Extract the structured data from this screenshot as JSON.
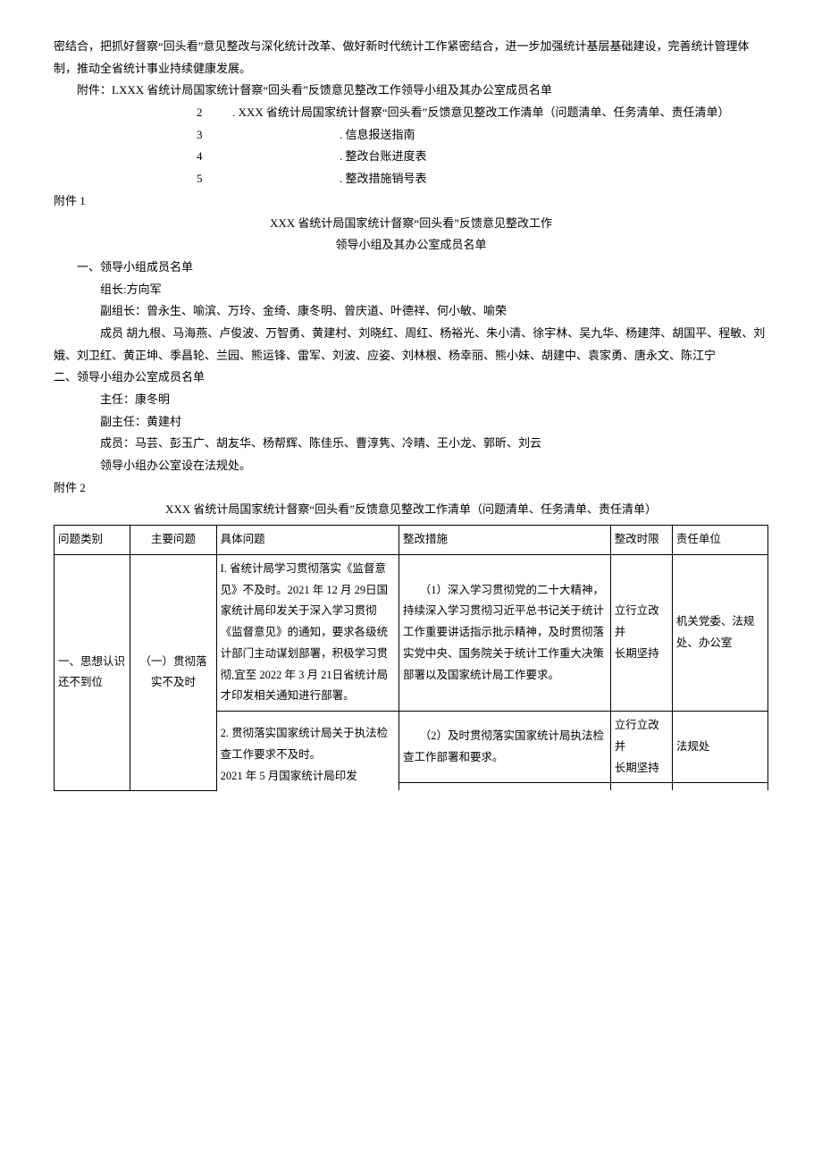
{
  "intro_para": "密结合，把抓好督察“回头看”意见整改与深化统计改革、做好新时代统计工作紧密结合，进一步加强统计基层基础建设，完善统计管理体制，推动全省统计事业持续健康发展。",
  "attach_label": "附件：",
  "attachments": {
    "a1": "LXXX 省统计局国家统计督察“回头看”反馈意见整改工作领导小组及其办公室成员名单",
    "a2_num": "2",
    "a2_text": ". XXX 省统计局国家统计督察“回头看”反馈意见整改工作清单（问题清单、任务清单、责任清单）",
    "a3_num": "3",
    "a3_text": ". 信息报送指南",
    "a4_num": "4",
    "a4_text": ". 整改台账进度表",
    "a5_num": "5",
    "a5_text": ". 整改措施销号表"
  },
  "fj1_label": "附件 1",
  "fj1_title1": "XXX 省统计局国家统计督察“回头看”反馈意见整改工作",
  "fj1_title2": "领导小组及其办公室成员名单",
  "sec1_title": "一、领导小组成员名单",
  "leader_label": "组长:方向军",
  "vice_label": "副组长：曾永生、喻滨、万玲、金绮、康冬明、曾庆道、叶德祥、何小敏、喻荣",
  "members_text": "成员 胡九根、马海燕、卢俊波、万智勇、黄建村、刘晓红、周红、杨裕光、朱小清、徐宇林、吴九华、杨建萍、胡国平、程敏、刘娥、刘卫红、黄正坤、季昌轮、兰园、熊运锋、雷军、刘波、应姿、刘林根、杨幸丽、熊小妹、胡建中、袁家勇、唐永文、陈江宁",
  "sec2_title": "二、领导小组办公室成员名单",
  "office_head": "主任：康冬明",
  "office_vice": "副主任：黄建村",
  "office_members": "成员：马芸、彭玉广、胡友华、杨帮辉、陈佳乐、曹淳隽、冷晴、王小龙、郭昕、刘云",
  "office_loc": "领导小组办公室设在法规处。",
  "fj2_label": "附件 2",
  "fj2_title": "XXX 省统计局国家统计督察“回头看”反馈意见整改工作清单（问题清单、任务清单、责任清单）",
  "table": {
    "headers": {
      "cat": "问题类别",
      "main": "主要问题",
      "spec": "具体问题",
      "meas": "整改措施",
      "time": "整改时限",
      "unit": "责任单位"
    },
    "row1": {
      "cat": "一、思想认识还不到位",
      "main": "（一）贯彻落实不及时",
      "spec": "I. 省统计局学习贯彻落实《监督意见》不及时。2021 年 12 月 29日国家统计局印发关于深入学习贯彻《监督意见》的通知，要求各级统计部门主动谋划部署，积极学习贯彻,宜至 2022 年 3 月 21日省统计局才印发相关通知进行部署。",
      "meas": "（1）深入学习贯彻党的二十大精神，持续深入学习贯彻习近平总书记关于统计工作重要讲话指示批示精神，及时贯彻落实党中央、国务院关于统计工作重大决策部署以及国家统计局工作要求。",
      "time": "立行立改并\n长期坚持",
      "unit": "机关党委、法规处、办公室"
    },
    "row2": {
      "meas": "（2）及时贯彻落实国家统计局执法检查工作部署和要求。",
      "time": "立行立改并\n长期坚持",
      "unit": "法规处"
    },
    "row3": {
      "spec": "2. 贯彻落实国家统计局关于执法检查工作要求不及时。\n2021 年 5 月国家统计局印发"
    }
  }
}
